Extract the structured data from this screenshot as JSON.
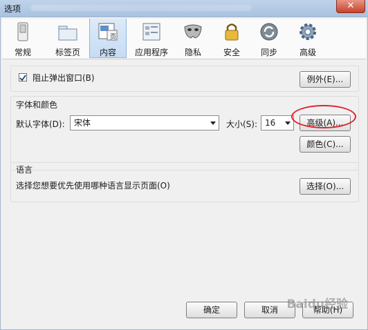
{
  "window": {
    "title": "选项",
    "close_label": "✕"
  },
  "toolbar": {
    "tabs": [
      {
        "label": "常规",
        "icon": "switch-icon"
      },
      {
        "label": "标签页",
        "icon": "folder-tabs-icon"
      },
      {
        "label": "内容",
        "icon": "content-page-icon",
        "active": true
      },
      {
        "label": "应用程序",
        "icon": "applications-icon"
      },
      {
        "label": "隐私",
        "icon": "mask-icon"
      },
      {
        "label": "安全",
        "icon": "lock-icon"
      },
      {
        "label": "同步",
        "icon": "sync-icon"
      },
      {
        "label": "高级",
        "icon": "gear-icon"
      }
    ]
  },
  "popup": {
    "checkbox_checked": true,
    "label": "阻止弹出窗口(B)",
    "exceptions_button": "例外(E)..."
  },
  "fonts": {
    "group_title": "字体和颜色",
    "default_font_label": "默认字体(D):",
    "default_font_value": "宋体",
    "size_label": "大小(S):",
    "size_value": "16",
    "advanced_button": "高级(A)...",
    "colors_button": "颜色(C)..."
  },
  "language": {
    "group_title": "语言",
    "description": "选择您想要优先使用哪种语言显示页面(O)",
    "choose_button": "选择(O)..."
  },
  "footer": {
    "ok_button": "确定",
    "cancel_button": "取消",
    "help_button": "帮助(H)"
  },
  "watermark": "Baidu经验",
  "colors": {
    "annotation": "#e0202b",
    "active_tab": "#c6dcf4"
  }
}
